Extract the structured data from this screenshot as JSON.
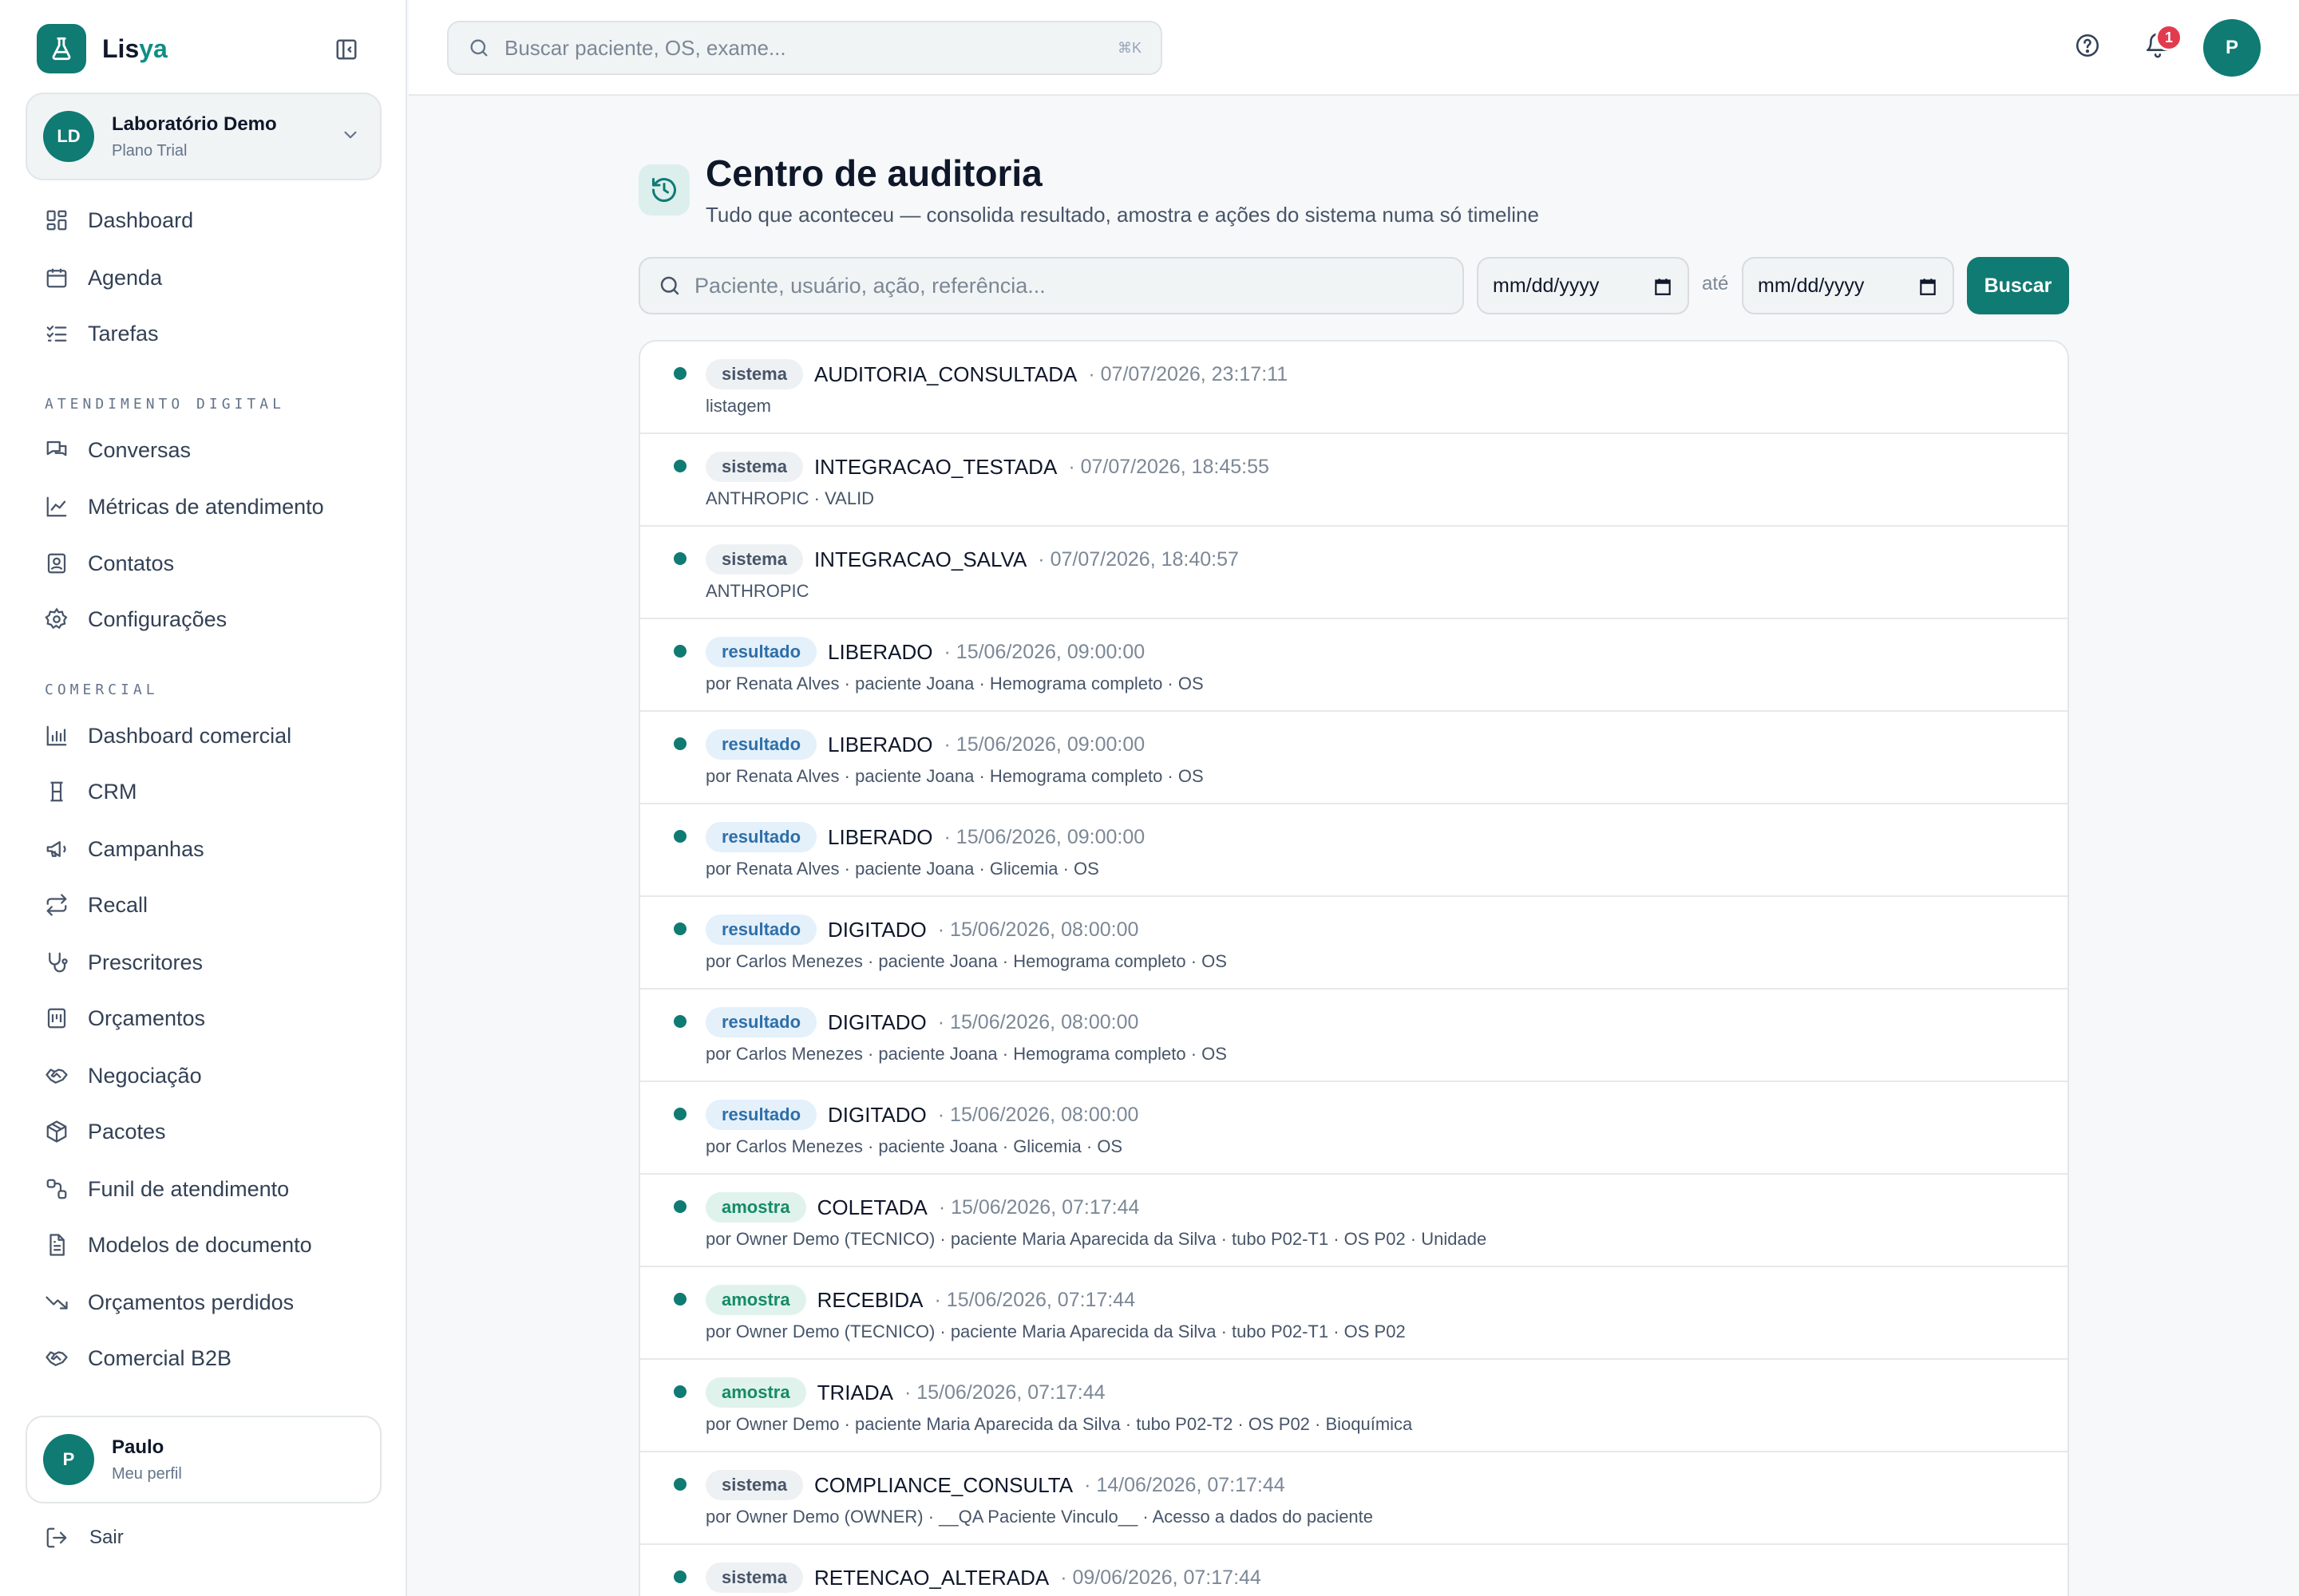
{
  "brand": {
    "name_main": "Lis",
    "name_accent": "ya"
  },
  "org": {
    "initials": "LD",
    "name": "Laboratório Demo",
    "plan": "Plano Trial"
  },
  "nav_main": [
    {
      "label": "Dashboard",
      "icon": "dashboard-icon"
    },
    {
      "label": "Agenda",
      "icon": "calendar-icon"
    },
    {
      "label": "Tarefas",
      "icon": "tasks-icon"
    }
  ],
  "section_digital": "ATENDIMENTO DIGITAL",
  "nav_digital": [
    {
      "label": "Conversas",
      "icon": "chat-icon"
    },
    {
      "label": "Métricas de atendimento",
      "icon": "chart-line-icon"
    },
    {
      "label": "Contatos",
      "icon": "contact-icon"
    },
    {
      "label": "Configurações",
      "icon": "gear-icon"
    }
  ],
  "section_comercial": "COMERCIAL",
  "nav_comercial": [
    {
      "label": "Dashboard comercial",
      "icon": "bar-chart-icon"
    },
    {
      "label": "CRM",
      "icon": "crm-icon"
    },
    {
      "label": "Campanhas",
      "icon": "megaphone-icon"
    },
    {
      "label": "Recall",
      "icon": "repeat-icon"
    },
    {
      "label": "Prescritores",
      "icon": "stethoscope-icon"
    },
    {
      "label": "Orçamentos",
      "icon": "budget-icon"
    },
    {
      "label": "Negociação",
      "icon": "handshake-icon"
    },
    {
      "label": "Pacotes",
      "icon": "package-icon"
    },
    {
      "label": "Funil de atendimento",
      "icon": "funnel-icon"
    },
    {
      "label": "Modelos de documento",
      "icon": "document-icon"
    },
    {
      "label": "Orçamentos perdidos",
      "icon": "trending-down-icon"
    },
    {
      "label": "Comercial B2B",
      "icon": "handshake-icon"
    }
  ],
  "profile": {
    "initial": "P",
    "name": "Paulo",
    "subtitle": "Meu perfil"
  },
  "logout_label": "Sair",
  "topbar": {
    "search_placeholder": "Buscar paciente, OS, exame...",
    "shortcut": "⌘K",
    "notifications_count": "1",
    "user_initial": "P"
  },
  "page": {
    "title": "Centro de auditoria",
    "subtitle": "Tudo que aconteceu — consolida resultado, amostra e ações do sistema numa só timeline"
  },
  "filters": {
    "search_placeholder": "Paciente, usuário, ação, referência...",
    "date_from": "mm/dd/yyyy",
    "separator": "até",
    "date_to": "mm/dd/yyyy",
    "submit_label": "Buscar"
  },
  "entries": [
    {
      "type": "sistema",
      "action": "AUDITORIA_CONSULTADA",
      "when": "· 07/07/2026, 23:17:11",
      "details": "listagem"
    },
    {
      "type": "sistema",
      "action": "INTEGRACAO_TESTADA",
      "when": "· 07/07/2026, 18:45:55",
      "details": "ANTHROPIC · VALID"
    },
    {
      "type": "sistema",
      "action": "INTEGRACAO_SALVA",
      "when": "· 07/07/2026, 18:40:57",
      "details": "ANTHROPIC"
    },
    {
      "type": "resultado",
      "action": "LIBERADO",
      "when": "· 15/06/2026, 09:00:00",
      "details": "por Renata Alves · paciente Joana · Hemograma completo · OS"
    },
    {
      "type": "resultado",
      "action": "LIBERADO",
      "when": "· 15/06/2026, 09:00:00",
      "details": "por Renata Alves · paciente Joana · Hemograma completo · OS"
    },
    {
      "type": "resultado",
      "action": "LIBERADO",
      "when": "· 15/06/2026, 09:00:00",
      "details": "por Renata Alves · paciente Joana · Glicemia · OS"
    },
    {
      "type": "resultado",
      "action": "DIGITADO",
      "when": "· 15/06/2026, 08:00:00",
      "details": "por Carlos Menezes · paciente Joana · Hemograma completo · OS"
    },
    {
      "type": "resultado",
      "action": "DIGITADO",
      "when": "· 15/06/2026, 08:00:00",
      "details": "por Carlos Menezes · paciente Joana · Hemograma completo · OS"
    },
    {
      "type": "resultado",
      "action": "DIGITADO",
      "when": "· 15/06/2026, 08:00:00",
      "details": "por Carlos Menezes · paciente Joana · Glicemia · OS"
    },
    {
      "type": "amostra",
      "action": "COLETADA",
      "when": "· 15/06/2026, 07:17:44",
      "details": "por Owner Demo (TECNICO) · paciente Maria Aparecida da Silva · tubo P02-T1 · OS P02 · Unidade"
    },
    {
      "type": "amostra",
      "action": "RECEBIDA",
      "when": "· 15/06/2026, 07:17:44",
      "details": "por Owner Demo (TECNICO) · paciente Maria Aparecida da Silva · tubo P02-T1 · OS P02"
    },
    {
      "type": "amostra",
      "action": "TRIADA",
      "when": "· 15/06/2026, 07:17:44",
      "details": "por Owner Demo · paciente Maria Aparecida da Silva · tubo P02-T2 · OS P02 · Bioquímica"
    },
    {
      "type": "sistema",
      "action": "COMPLIANCE_CONSULTA",
      "when": "· 14/06/2026, 07:17:44",
      "details": "por Owner Demo (OWNER) · __QA Paciente Vinculo__ · Acesso a dados do paciente"
    },
    {
      "type": "sistema",
      "action": "RETENCAO_ALTERADA",
      "when": "· 09/06/2026, 07:17:44",
      "details": ""
    }
  ],
  "colors": {
    "brand": "#0f7b73",
    "notification": "#e23b4e"
  }
}
